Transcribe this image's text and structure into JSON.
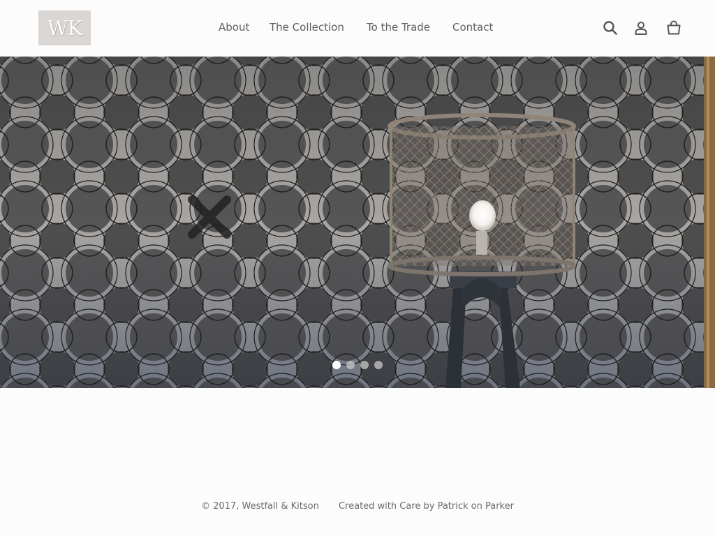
{
  "brand": {
    "logo_text": "WK"
  },
  "nav": {
    "items": [
      {
        "label": "About"
      },
      {
        "label": "The Collection"
      },
      {
        "label": "To the Trade"
      },
      {
        "label": "Contact"
      }
    ]
  },
  "header_icons": [
    "search-icon",
    "account-icon",
    "cart-icon"
  ],
  "hero": {
    "slide_count": 4,
    "active_slide": 1
  },
  "footer": {
    "copyright": "© 2017, Westfall & Kitson",
    "credit": "Created with Care by Patrick on Parker"
  },
  "colors": {
    "background": "#fdfcfc",
    "nav_text": "#5f5f5f",
    "logo_bg": "#d9d6d3"
  }
}
